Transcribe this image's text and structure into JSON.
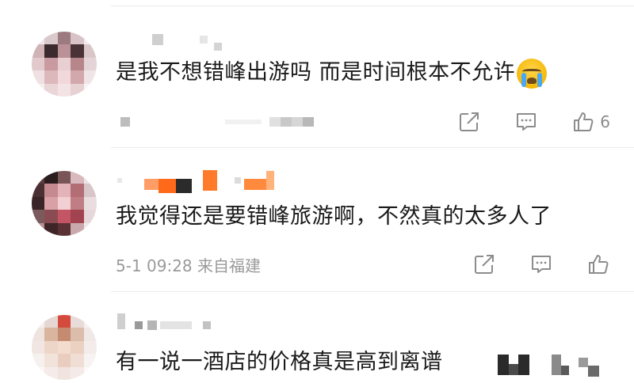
{
  "comments": [
    {
      "text": "是我不想错峰出游吗 而是时间根本不允许",
      "emoji": "crying-face",
      "meta": "",
      "like_count": "6"
    },
    {
      "text": "我觉得还是要错峰旅游啊，不然真的太多人了",
      "meta": "5-1 09:28 来自福建",
      "like_count": ""
    },
    {
      "text": "有一说一酒店的价格真是高到离谱"
    }
  ],
  "icons": {
    "share": "share-icon",
    "reply": "comment-icon",
    "like": "thumbs-up-icon"
  },
  "colors": {
    "text": "#1a1a1a",
    "meta": "#9a9a9a",
    "icon": "#8c8c8c",
    "divider": "#ececec",
    "highlight_orange": "#ff6a1a"
  }
}
